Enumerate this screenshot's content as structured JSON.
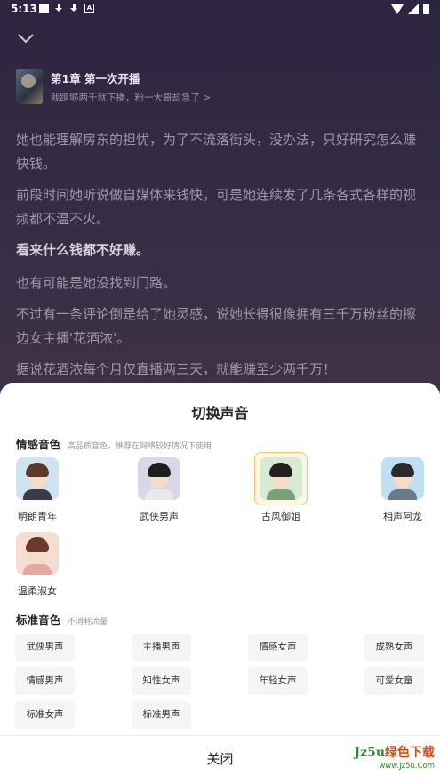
{
  "statusbar": {
    "time": "5:13"
  },
  "reader": {
    "chapter_title": "第1章  第一次开播",
    "chapter_subtitle": "我蹭够两千就下播，粉一大哥却急了 >",
    "paragraphs": [
      {
        "text": "她也能理解房东的担忧，为了不流落街头，没办法，只好研究怎么赚快钱。",
        "bold": false
      },
      {
        "text": "前段时间她听说做自媒体来钱快，可是她连续发了几条各式各样的视频都不温不火。",
        "bold": false
      },
      {
        "text": "看来什么钱都不好赚。",
        "bold": true
      },
      {
        "text": "也有可能是她没找到门路。",
        "bold": false
      },
      {
        "text": "不过有一条评论倒是给了她灵感，说她长得很像拥有三千万粉丝的擦边女主播'花酒浓'。",
        "bold": false
      },
      {
        "text": "据说花酒浓每个月仅直播两三天，就能赚至少两千万！",
        "bold": false
      }
    ]
  },
  "sheet": {
    "title": "切换声音",
    "emotional": {
      "name": "情感音色",
      "hint": "高品质音色，推荐在网络较好情况下使用",
      "voices": [
        {
          "label": "明朗青年",
          "selected": false
        },
        {
          "label": "武侠男声",
          "selected": false
        },
        {
          "label": "古风御姐",
          "selected": true
        },
        {
          "label": "相声阿龙",
          "selected": false
        },
        {
          "label": "温柔淑女",
          "selected": false
        }
      ]
    },
    "standard": {
      "name": "标准音色",
      "hint": "不消耗流量",
      "chips": [
        "武侠男声",
        "主播男声",
        "情感女声",
        "成熟女声",
        "情感男声",
        "知性女声",
        "年轻女声",
        "可爱女童",
        "标准女声",
        "标准男声"
      ]
    },
    "close_label": "关闭"
  },
  "watermark": {
    "main_a": "Jz5u",
    "main_b": "绿色下载",
    "sub": "www.Jz5u.Com"
  }
}
